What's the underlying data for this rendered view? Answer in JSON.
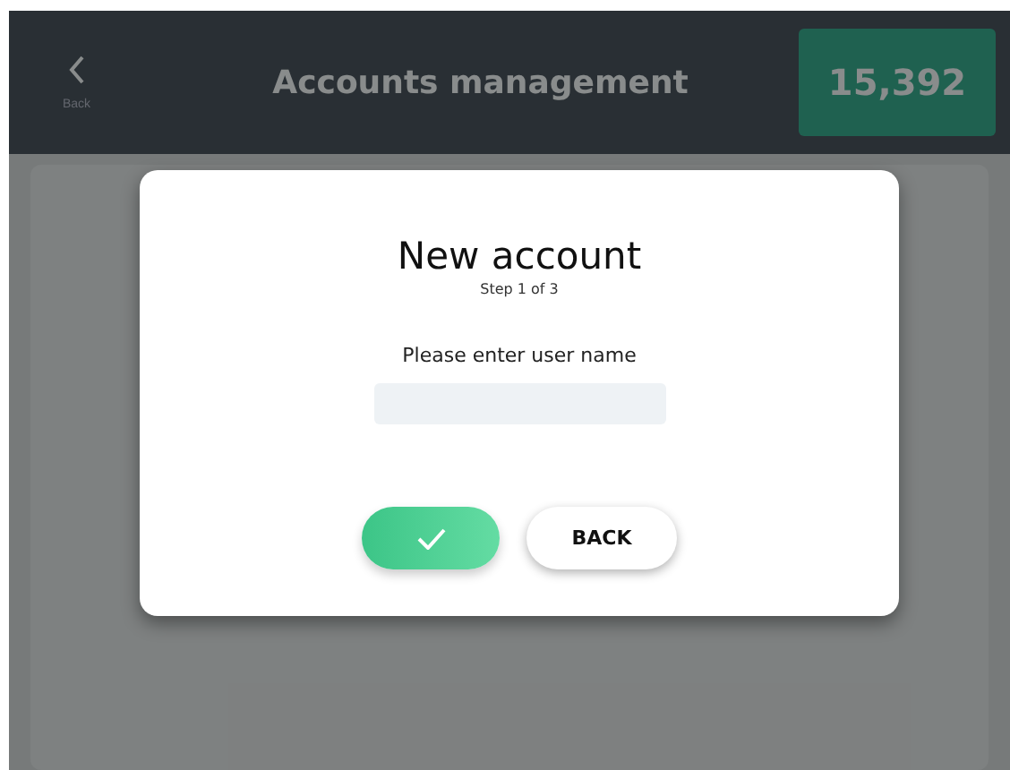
{
  "header": {
    "back_label": "Back",
    "title": "Accounts management",
    "badge_value": "15,392"
  },
  "dialog": {
    "title": "New account",
    "step": "Step 1 of 3",
    "prompt": "Please enter user name",
    "buttons": [
      {
        "kind": "confirm"
      },
      {
        "kind": "text",
        "label": "BACK"
      }
    ]
  }
}
